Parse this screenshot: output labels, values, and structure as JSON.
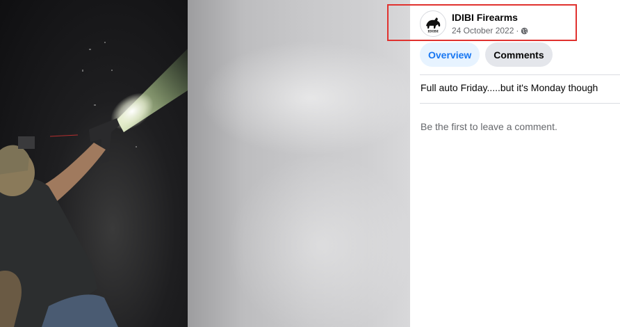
{
  "post": {
    "page_name": "IDIBI Firearms",
    "date": "24 October 2022",
    "separator": "·",
    "audience_icon": "globe-icon",
    "avatar_text": "IDIBI",
    "caption": "Full auto Friday.....but it's Monday though"
  },
  "tabs": [
    {
      "label": "Overview",
      "active": true
    },
    {
      "label": "Comments",
      "active": false
    }
  ],
  "comments": {
    "empty_text": "Be the first to leave a comment."
  },
  "colors": {
    "accent": "#1877f2",
    "highlight_box": "#e0312e",
    "secondary_text": "#65676b"
  }
}
